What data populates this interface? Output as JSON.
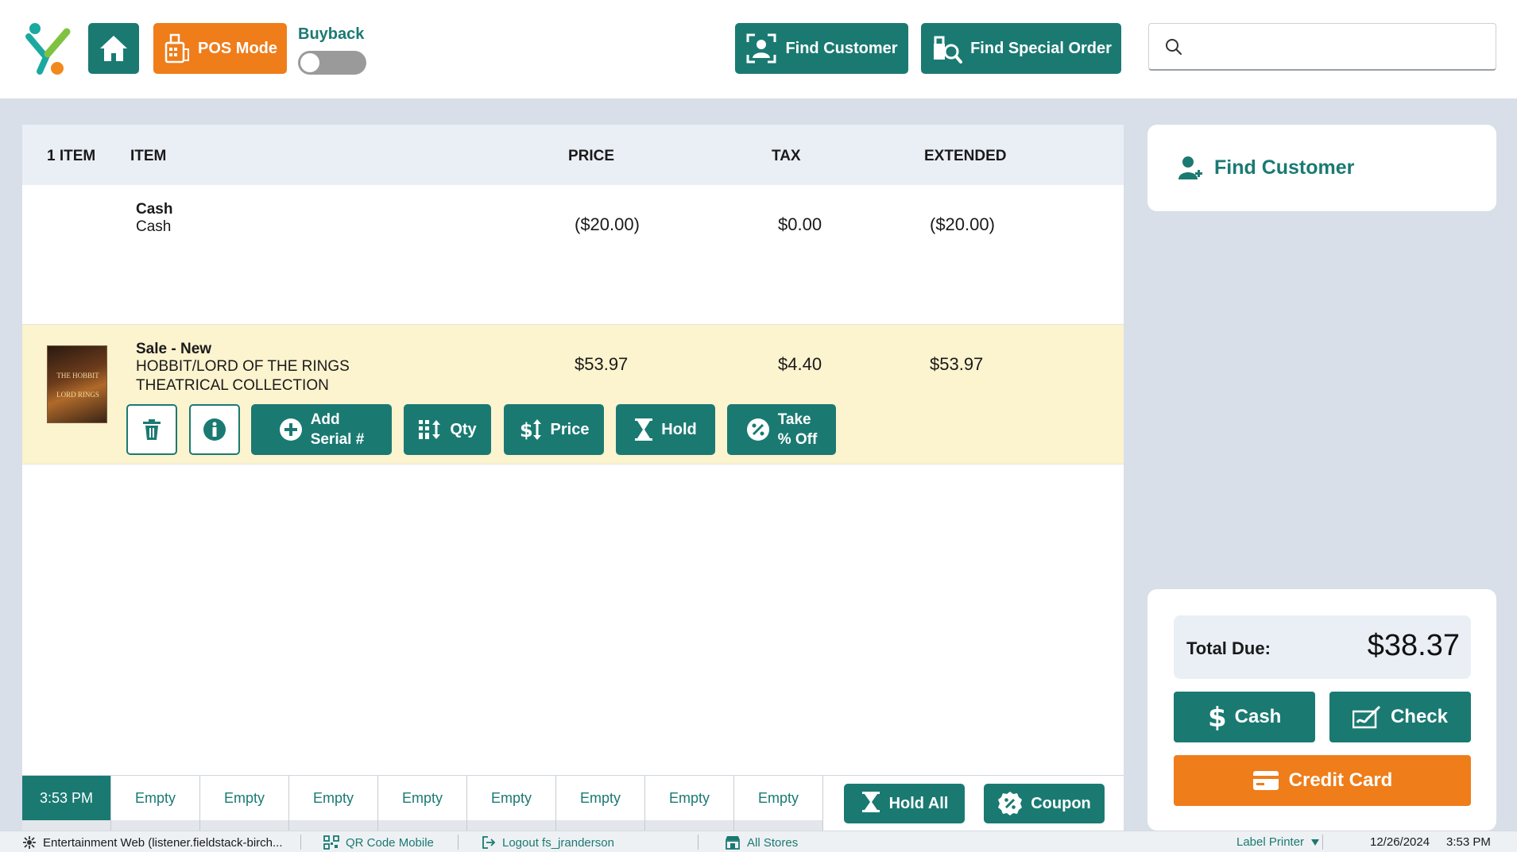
{
  "header": {
    "pos_mode_label": "POS Mode",
    "buyback_label": "Buyback",
    "find_customer_label": "Find Customer",
    "find_special_order_label": "Find Special Order",
    "search_placeholder": ""
  },
  "cart": {
    "columns": [
      "1 ITEM",
      "ITEM",
      "PRICE",
      "TAX",
      "EXTENDED"
    ],
    "rows": [
      {
        "type": "Cash",
        "description": "Cash",
        "price": "($20.00)",
        "tax": "$0.00",
        "extended": "($20.00)"
      },
      {
        "type": "Sale - New",
        "description_line1": "HOBBIT/LORD OF THE RINGS",
        "description_line2": "THEATRICAL COLLECTION",
        "price": "$53.97",
        "tax": "$4.40",
        "extended": "$53.97"
      }
    ],
    "actions": {
      "add_serial_1": "Add",
      "add_serial_2": "Serial #",
      "qty": "Qty",
      "price": "Price",
      "hold": "Hold",
      "take_off_1": "Take",
      "take_off_2": "% Off"
    }
  },
  "holds": {
    "active_time": "3:53 PM",
    "slots": [
      "Empty",
      "Empty",
      "Empty",
      "Empty",
      "Empty",
      "Empty",
      "Empty",
      "Empty"
    ],
    "hold_all_label": "Hold All",
    "coupon_label": "Coupon"
  },
  "customer_panel": {
    "label": "Find Customer"
  },
  "payment": {
    "total_label": "Total Due:",
    "total_value": "$38.37",
    "cash_label": "Cash",
    "check_label": "Check",
    "credit_card_label": "Credit Card"
  },
  "status": {
    "app": "Entertainment Web (listener.fieldstack-birch...",
    "qr": "QR Code Mobile",
    "logout": "Logout fs_jranderson",
    "stores": "All Stores",
    "printer": "Label Printer",
    "date": "12/26/2024",
    "time": "3:53 PM"
  },
  "colors": {
    "teal": "#1a7a72",
    "orange": "#ef7d1a",
    "highlight": "#fcf3cf"
  }
}
